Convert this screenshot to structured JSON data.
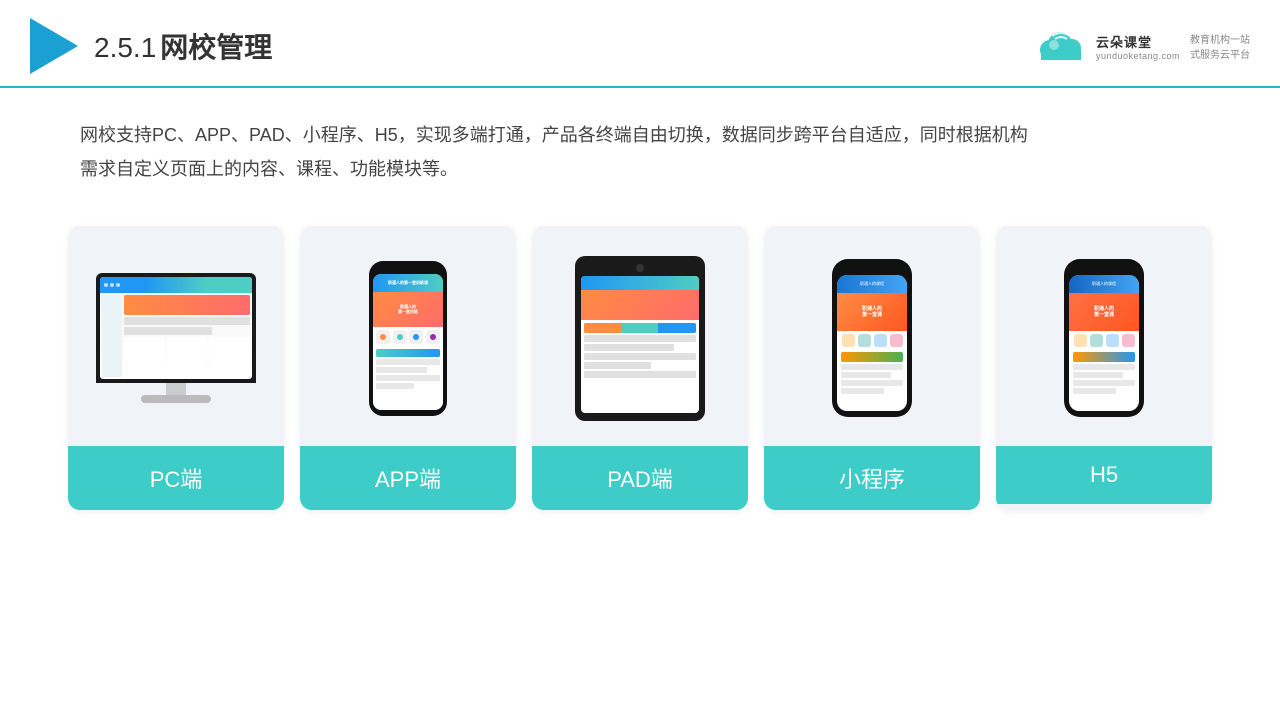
{
  "header": {
    "title": "网校管理",
    "title_prefix": "2.5.1",
    "brand_name": "云朵课堂",
    "brand_url": "yunduoketang.com",
    "brand_slogan1": "教育机构一站",
    "brand_slogan2": "式服务云平台"
  },
  "description": {
    "text1": "网校支持PC、APP、PAD、小程序、H5，实现多端打通，产品各终端自由切换，数据同步跨平台自适应，同时根据机构",
    "text2": "需求自定义页面上的内容、课程、功能模块等。"
  },
  "cards": [
    {
      "id": "pc",
      "label": "PC端"
    },
    {
      "id": "app",
      "label": "APP端"
    },
    {
      "id": "pad",
      "label": "PAD端"
    },
    {
      "id": "miniprogram",
      "label": "小程序"
    },
    {
      "id": "h5",
      "label": "H5"
    }
  ]
}
